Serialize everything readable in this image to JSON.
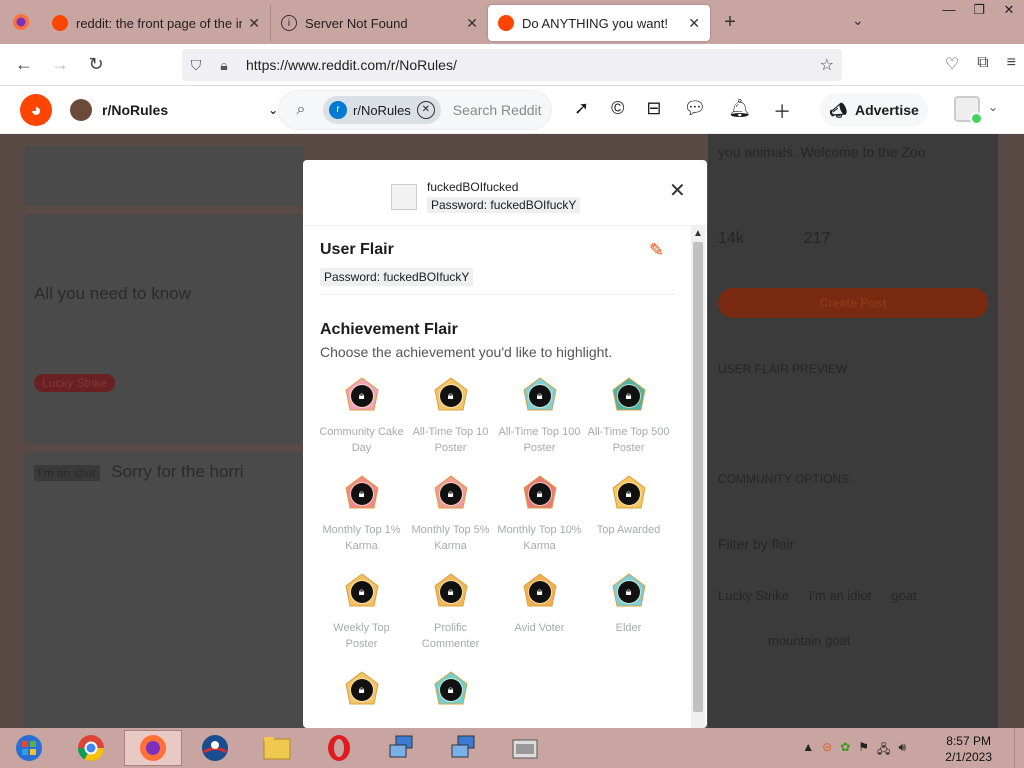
{
  "browser": {
    "tabs": [
      {
        "title": "reddit: the front page of the internet",
        "active": false
      },
      {
        "title": "Server Not Found",
        "active": false
      },
      {
        "title": "Do ANYTHING you want!",
        "active": true
      }
    ],
    "new_tab": "+",
    "url": "https://www.reddit.com/r/NoRules/"
  },
  "reddit_header": {
    "community": "r/NoRules",
    "search_chip": "r/NoRules",
    "search_placeholder": "Search Reddit",
    "advertise_label": "Advertise"
  },
  "modal": {
    "username": "fuckedBOIfucked",
    "password_flair": "Password: fuckedBOIfuckY",
    "user_flair_heading": "User Flair",
    "user_flair_value": "Password: fuckedBOIfuckY",
    "achievement_heading": "Achievement Flair",
    "achievement_sub": "Choose the achievement you'd like to highlight.",
    "achievements": [
      {
        "label": "Community Cake Day",
        "color": "#f2a3b8"
      },
      {
        "label": "All-Time Top 10 Poster",
        "color": "#f4c46a"
      },
      {
        "label": "All-Time Top 100 Poster",
        "color": "#7fd0d8"
      },
      {
        "label": "All-Time Top 500 Poster",
        "color": "#4fb3a6"
      },
      {
        "label": "Monthly Top 1% Karma",
        "color": "#f08a8a"
      },
      {
        "label": "Monthly Top 5% Karma",
        "color": "#f09a9a"
      },
      {
        "label": "Monthly Top 10% Karma",
        "color": "#e87a7a"
      },
      {
        "label": "Top Awarded",
        "color": "#f5c75f"
      },
      {
        "label": "Weekly Top Poster",
        "color": "#f3c062"
      },
      {
        "label": "Prolific Commenter",
        "color": "#efb85a"
      },
      {
        "label": "Avid Voter",
        "color": "#f0b050"
      },
      {
        "label": "Elder",
        "color": "#7ccfd8"
      },
      {
        "label": "",
        "color": "#f4c46a"
      },
      {
        "label": "",
        "color": "#6fd0d0"
      }
    ]
  },
  "background": {
    "post_title_1": "All you need to know",
    "post_title_2": "Sorry for the horri",
    "tag_1": "Lucky Strike",
    "tag_2": "I'm an idiot",
    "right_intro": "you animals. Welcome to the Zoo",
    "members": "14k",
    "online": "217",
    "create_post": "Create Post",
    "user_flair_preview": "USER FLAIR PREVIEW",
    "community_options": "COMMUNITY OPTIONS",
    "filter_by_flair": "Filter by flair",
    "flair_a": "Lucky Strike",
    "flair_b": "I'm an idiot",
    "flair_c": "goat",
    "flair_d": "mountain goat"
  },
  "taskbar": {
    "time": "8:57 PM",
    "date": "2/1/2023"
  },
  "colors": {
    "reddit_orange": "#ff4500",
    "chrome_bg": "#c9a5a1"
  }
}
